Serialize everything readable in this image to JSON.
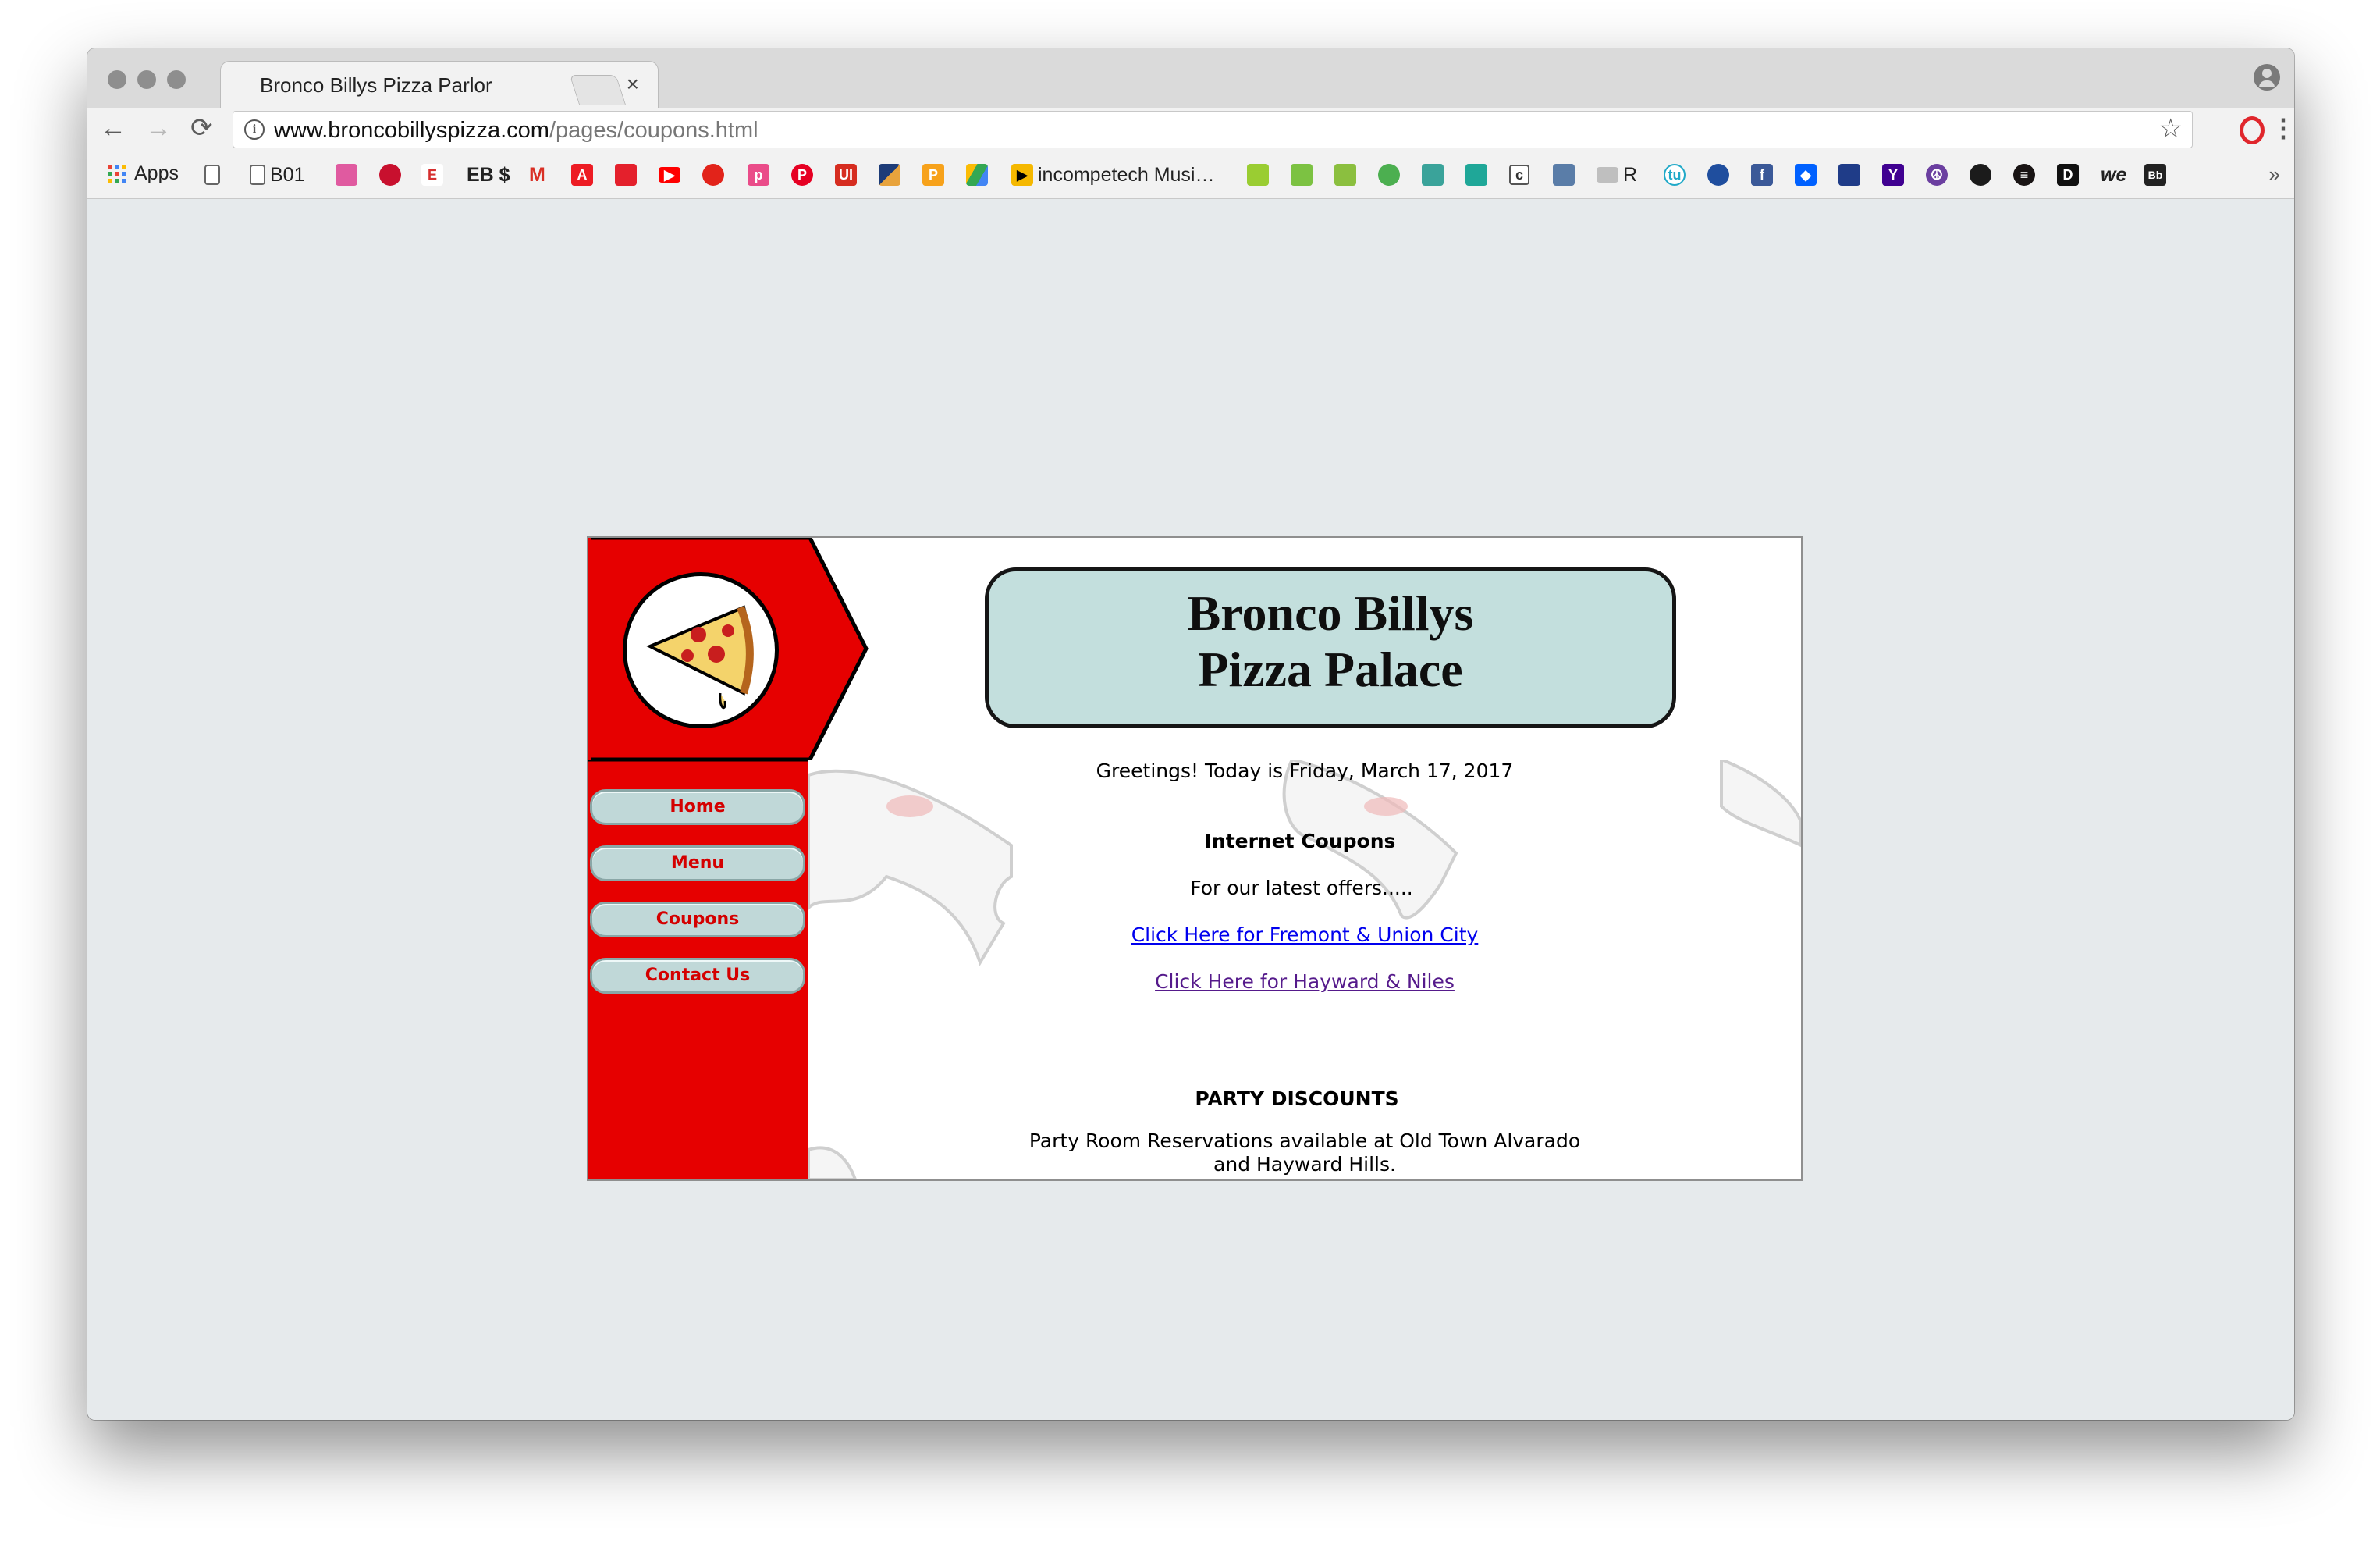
{
  "browser": {
    "tab_title": "Bronco Billys Pizza Parlor",
    "tab_close": "×",
    "url_host": "www.broncobillyspizza.com",
    "url_path": "/pages/coupons.html",
    "nav": {
      "back": "←",
      "forward": "→",
      "reload": "⟳"
    },
    "star": "☆",
    "menu": "⋮"
  },
  "bookmarks": {
    "apps_label": "Apps",
    "items": [
      {
        "label": "",
        "icon": "page-icon"
      },
      {
        "label": "B01",
        "icon": "page-icon"
      },
      {
        "label": "",
        "icon": "icon-pink"
      },
      {
        "label": "",
        "icon": "bank-icon"
      },
      {
        "label": "EB",
        "icon": "eb-icon"
      },
      {
        "label": "EB $",
        "icon": "eb-icon"
      },
      {
        "label": "M",
        "icon": "gmail-icon"
      },
      {
        "label": "",
        "icon": "adobe-icon"
      },
      {
        "label": "",
        "icon": "icon-red"
      },
      {
        "label": "",
        "icon": "youtube-icon"
      },
      {
        "label": "",
        "icon": "icon-red-circle"
      },
      {
        "label": "p",
        "icon": "icon-pink-p"
      },
      {
        "label": "",
        "icon": "pinterest-icon"
      },
      {
        "label": "UI",
        "icon": "icon-ui"
      },
      {
        "label": "",
        "icon": "icon-flag"
      },
      {
        "label": "P",
        "icon": "icon-orange-p"
      },
      {
        "label": "",
        "icon": "drive-icon"
      },
      {
        "label": "incompetech Musi…",
        "icon": "play-icon"
      },
      {
        "label": "",
        "icon": "icon-green"
      },
      {
        "label": "",
        "icon": "icon-green2"
      },
      {
        "label": "",
        "icon": "icon-green3"
      },
      {
        "label": "",
        "icon": "icon-frog"
      },
      {
        "label": "",
        "icon": "icon-teal"
      },
      {
        "label": "",
        "icon": "icon-teal2"
      },
      {
        "label": "",
        "icon": "icon-c"
      },
      {
        "label": "",
        "icon": "icon-book"
      },
      {
        "label": "R",
        "icon": "folder-icon"
      },
      {
        "label": "",
        "icon": "icon-tu"
      },
      {
        "label": "",
        "icon": "icon-blue-circle"
      },
      {
        "label": "",
        "icon": "facebook-icon"
      },
      {
        "label": "",
        "icon": "dropbox-icon"
      },
      {
        "label": "",
        "icon": "icon-calendar"
      },
      {
        "label": "Y",
        "icon": "yahoo-icon"
      },
      {
        "label": "",
        "icon": "peace-icon"
      },
      {
        "label": "",
        "icon": "github-icon"
      },
      {
        "label": "",
        "icon": "spotify-icon"
      },
      {
        "label": "D",
        "icon": "d-icon"
      },
      {
        "label": "we",
        "icon": "we-icon"
      },
      {
        "label": "Bb",
        "icon": "bb-icon"
      }
    ],
    "more": "»"
  },
  "colors": {
    "site_red": "#e60000",
    "plaque": "#c3dfdd",
    "nav_text": "#d40000",
    "link": "#0000ee",
    "visited": "#551a8b"
  },
  "site": {
    "title_line1": "Bronco Billys",
    "title_line2": "Pizza Palace",
    "nav": [
      {
        "label": "Home"
      },
      {
        "label": "Menu"
      },
      {
        "label": "Coupons"
      },
      {
        "label": "Contact Us"
      }
    ],
    "greeting": "Greetings! Today is Friday, March 17, 2017",
    "coupons_heading": "Internet Coupons",
    "latest_offers": "For our latest offers.....",
    "link_fremont": "Click Here for Fremont & Union City",
    "link_hayward": "Click Here for Hayward & Niles",
    "party_heading": "PARTY DISCOUNTS",
    "party_line1": "Party Room Reservations available at Old Town Alvarado",
    "party_line2": "and Hayward Hills."
  }
}
